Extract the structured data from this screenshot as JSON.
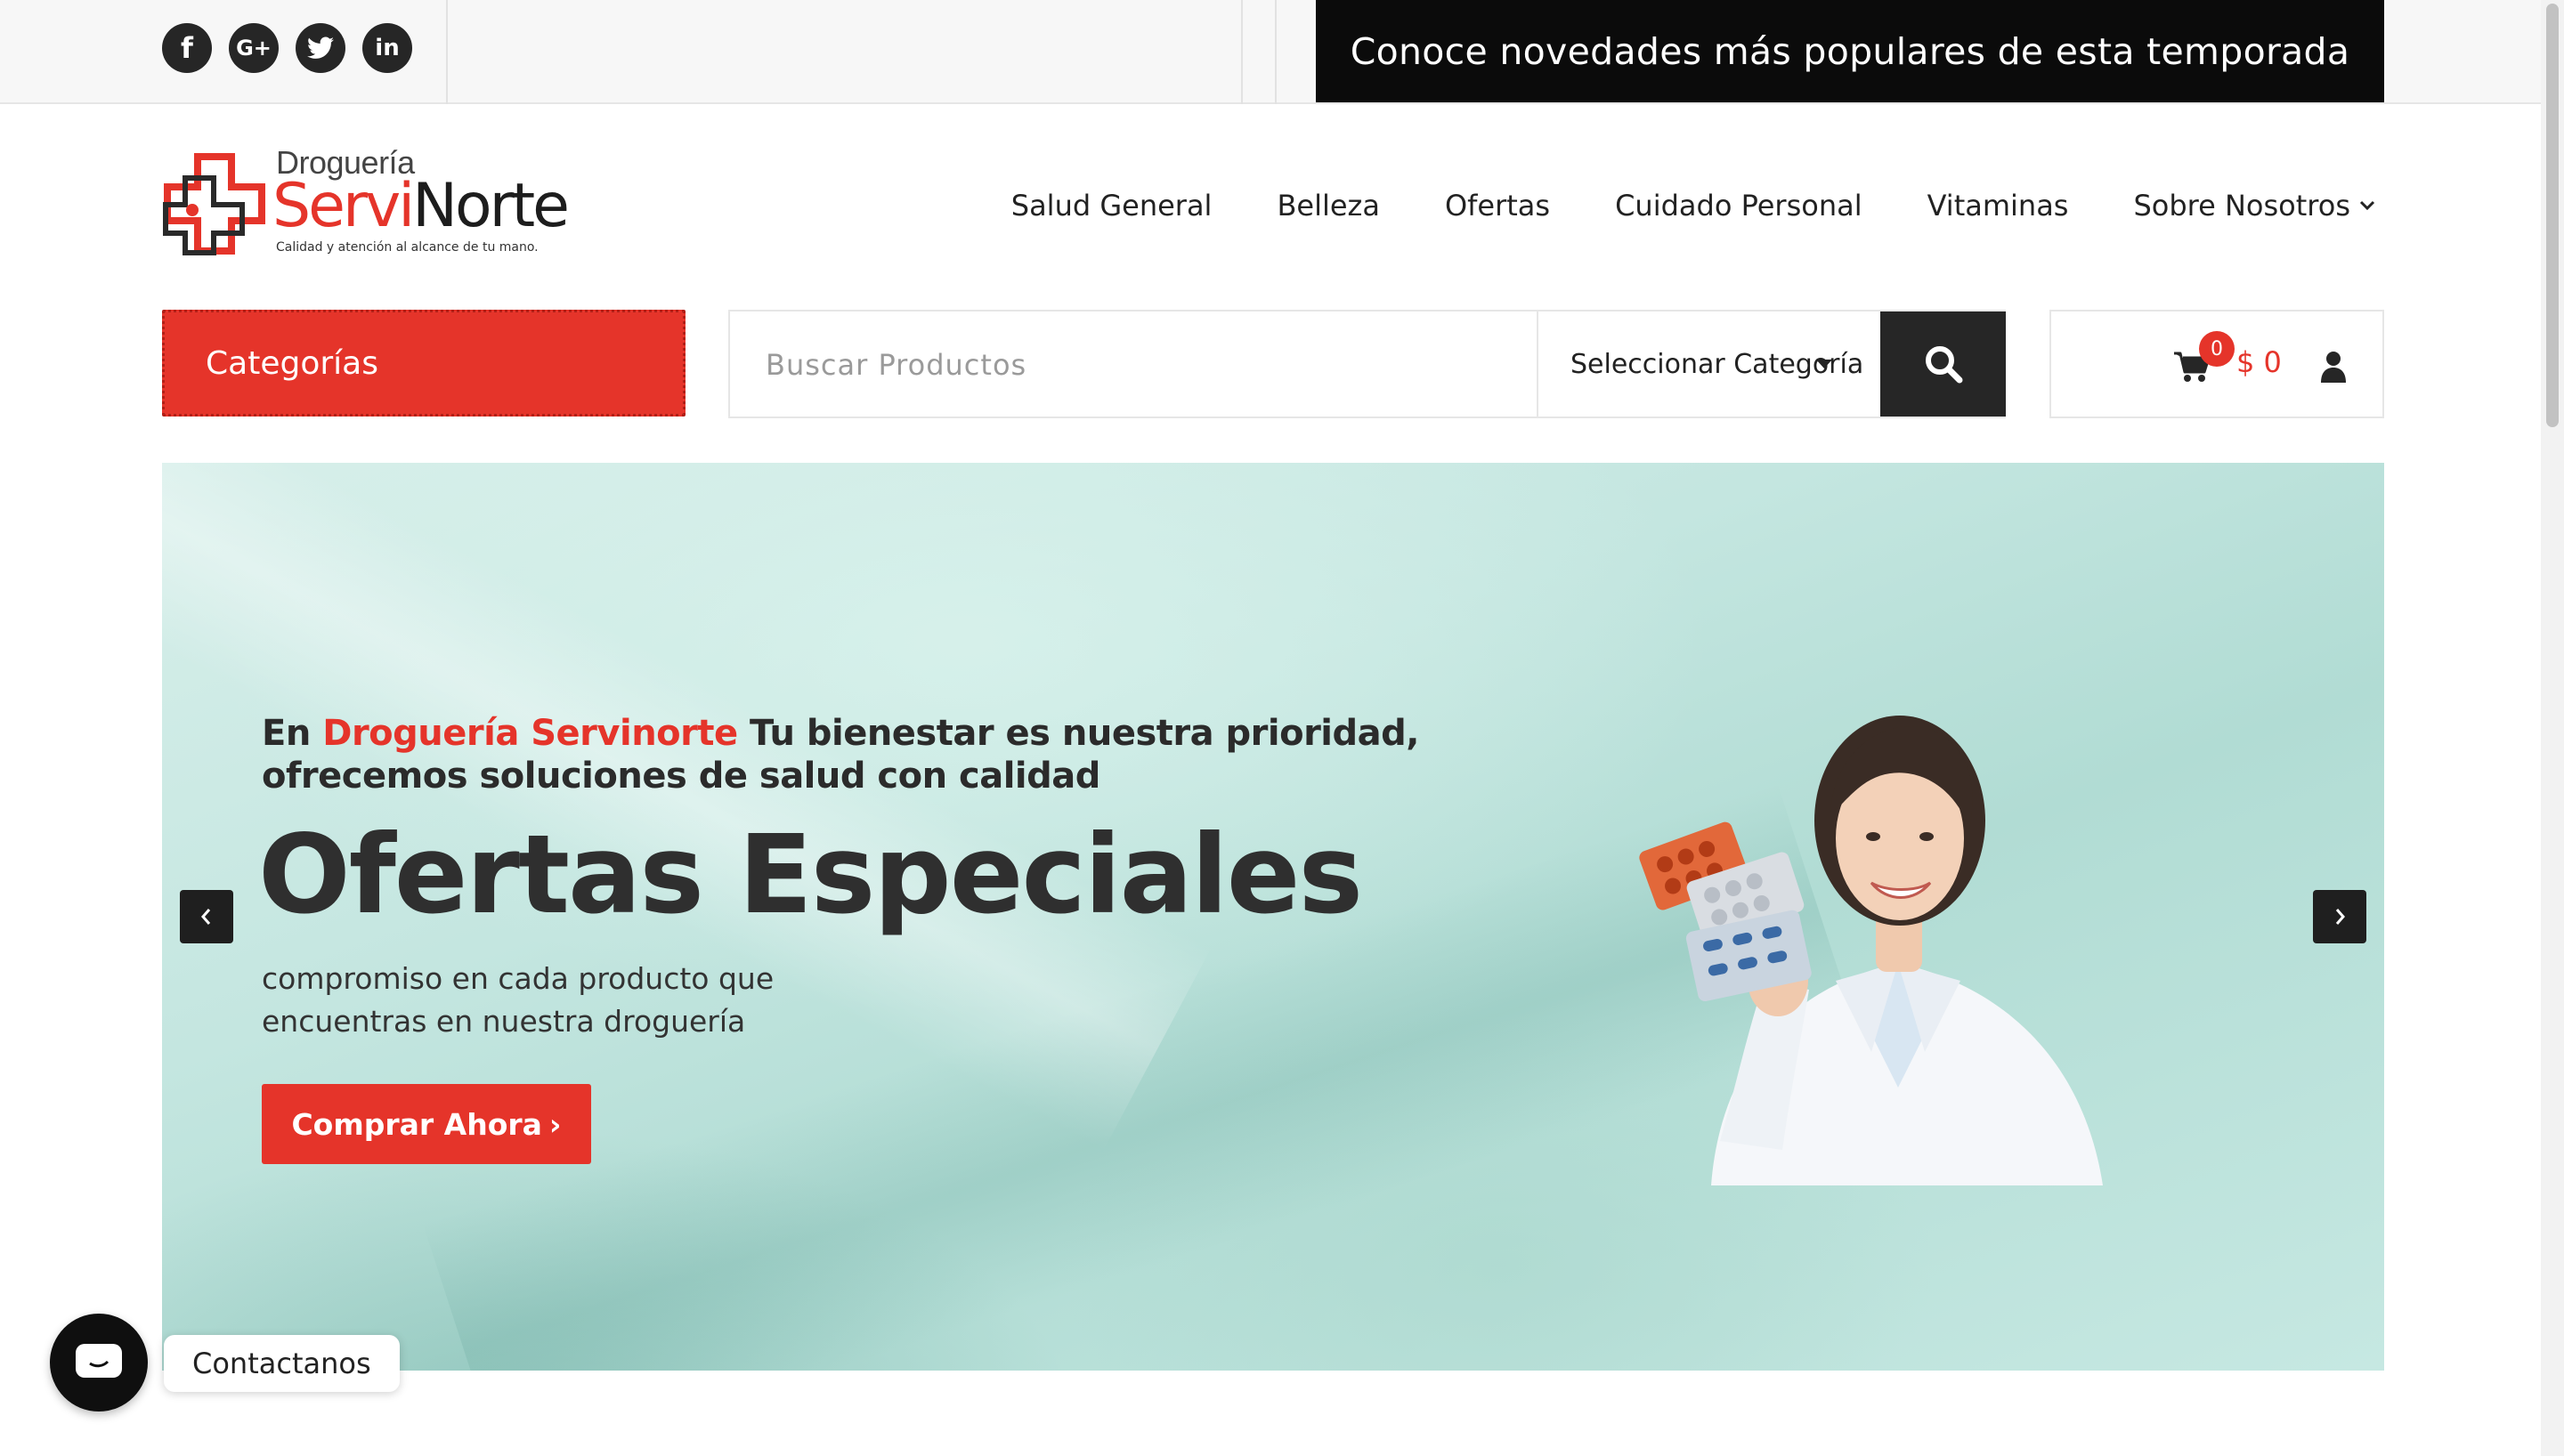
{
  "topbar": {
    "social": [
      {
        "icon": "facebook-icon",
        "glyph": "f"
      },
      {
        "icon": "google-plus-icon",
        "glyph": "G+"
      },
      {
        "icon": "twitter-icon",
        "glyph": "t"
      },
      {
        "icon": "linkedin-icon",
        "glyph": "in"
      }
    ],
    "promo_text": "Conoce novedades más populares de esta temporada"
  },
  "logo": {
    "top": "Droguería",
    "brand_part1": "Servi",
    "brand_part2": "Norte",
    "tagline": "Calidad y atención al alcance de tu mano."
  },
  "nav": {
    "items": [
      "Salud General",
      "Belleza",
      "Ofertas",
      "Cuidado Personal",
      "Vitaminas",
      "Sobre Nosotros"
    ]
  },
  "search": {
    "categories_label": "Categorías",
    "placeholder": "Buscar Productos",
    "value": "",
    "category_selected": "Seleccionar Categoría"
  },
  "cart": {
    "count": "0",
    "total": "$ 0"
  },
  "hero": {
    "intro_prefix": "En ",
    "intro_brand": "Droguería Servinorte",
    "intro_rest": " Tu bienestar es nuestra prioridad,",
    "intro_line2": "ofrecemos soluciones de salud con calidad",
    "headline": "Ofertas Especiales",
    "desc_line1": "compromiso en cada producto que",
    "desc_line2": "encuentras en nuestra droguería",
    "cta_label": "Comprar Ahora",
    "cta_chevron": "›"
  },
  "contact": {
    "label": "Contactanos"
  },
  "colors": {
    "brand_red": "#e5342a",
    "dark": "#262626",
    "promo_bg": "#0b0b0b"
  }
}
